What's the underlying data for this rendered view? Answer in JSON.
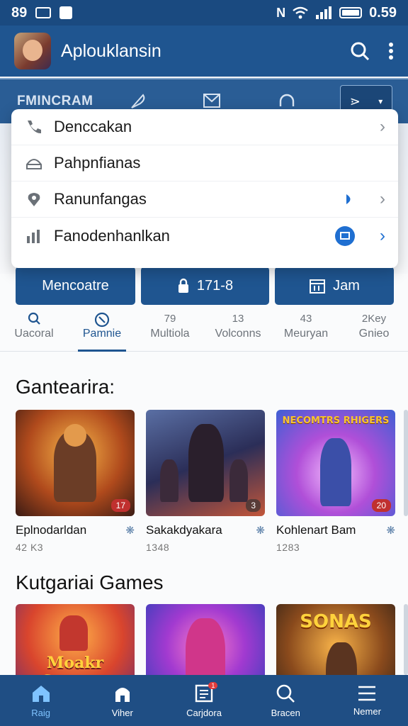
{
  "status_bar": {
    "left_text": "89",
    "right_text": "0.59",
    "icons": [
      "id-card-icon",
      "v-shield-icon",
      "no-sim-icon",
      "wifi-icon",
      "signal-icon",
      "battery-icon"
    ]
  },
  "app_bar": {
    "title": "Aplouklansin",
    "icons": [
      "search-icon",
      "more-vert-icon"
    ]
  },
  "tab_strip": {
    "label": "FMINCRAM",
    "icons": [
      "feather-icon",
      "mail-icon",
      "headset-icon",
      "share-icon",
      "chevron-down-icon"
    ]
  },
  "dropdown": {
    "items": [
      {
        "icon": "phone-icon",
        "label": "Denccakan"
      },
      {
        "icon": "home-icon",
        "label": "Pahpnfianas"
      },
      {
        "icon": "location-icon",
        "label": "Ranunfangas"
      },
      {
        "icon": "chart-icon",
        "label": "Fanodenhanlkan"
      }
    ]
  },
  "pills": [
    {
      "label": "Mencoatre"
    },
    {
      "icon": "lock-icon",
      "label": "171-8"
    },
    {
      "icon": "calendar-icon",
      "label": "Jam"
    }
  ],
  "categories": [
    {
      "top": "",
      "label": "Uacoral",
      "icon": "search-icon"
    },
    {
      "top": "",
      "label": "Pamnie",
      "icon": "compass-icon",
      "active": true
    },
    {
      "top": "79",
      "label": "Multiola"
    },
    {
      "top": "13",
      "label": "Volconns"
    },
    {
      "top": "43",
      "label": "Meuryan"
    },
    {
      "top": "2Key",
      "label": "Gnieo"
    }
  ],
  "sections": [
    {
      "title": "Gantearira:",
      "cards": [
        {
          "name": "Eplnodarldan",
          "meta": "42 K3",
          "badge": "17"
        },
        {
          "name": "Sakakdyakara",
          "meta": "1348",
          "badge": "3"
        },
        {
          "name": "Kohlenart Bam",
          "meta": "1283",
          "badge": "20",
          "art_text": "NECOMTRS RHIGERS"
        }
      ]
    },
    {
      "title": "Kutgariai Games",
      "cards": [
        {
          "name": "",
          "meta": "",
          "art_text": "Moakr Snnuna"
        },
        {
          "name": "",
          "meta": ""
        },
        {
          "name": "",
          "meta": "",
          "art_text": "SONAS"
        }
      ]
    }
  ],
  "bottom_nav": [
    {
      "icon": "home-icon",
      "label": "Raig",
      "active": true
    },
    {
      "icon": "store-icon",
      "label": "Viher"
    },
    {
      "icon": "list-icon",
      "label": "Carjdora",
      "badge": "1"
    },
    {
      "icon": "search-icon",
      "label": "Bracen"
    },
    {
      "icon": "menu-icon",
      "label": "Nemer"
    }
  ]
}
